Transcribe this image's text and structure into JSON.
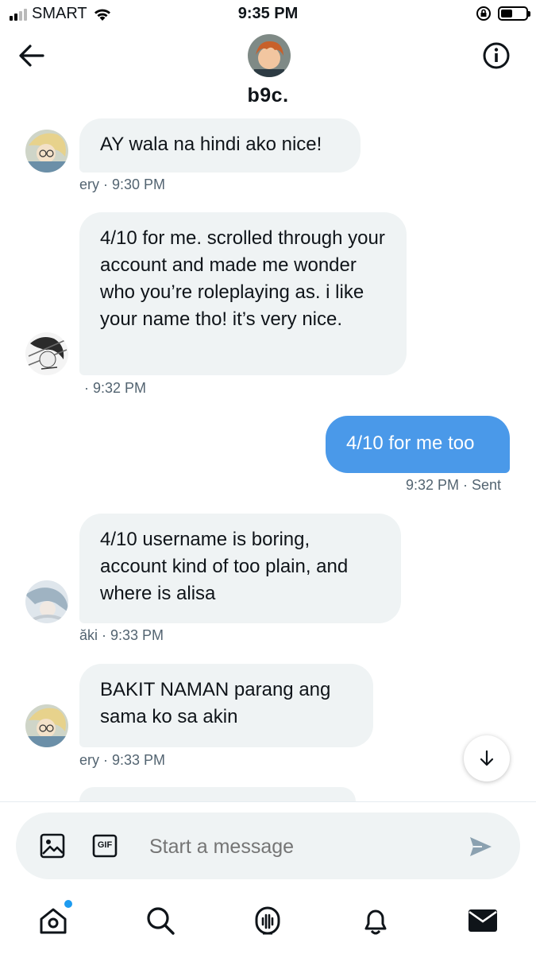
{
  "status_bar": {
    "carrier": "SMART",
    "time": "9:35 PM"
  },
  "header": {
    "title": "b9c.",
    "back_icon": "arrow-left-icon",
    "info_icon": "info-icon"
  },
  "messages": [
    {
      "text": "AY wala na hindi ako nice!",
      "meta": "ery · 9:30 PM",
      "direction": "received"
    },
    {
      "text": "4/10 for me. scrolled through your account and made me wonder who you’re roleplaying as. i like your name tho! it’s very nice.",
      "meta": "· 9:32 PM",
      "direction": "received"
    },
    {
      "text": "4/10 for me too",
      "meta": "9:32 PM  · Sent",
      "direction": "sent"
    },
    {
      "text": "4/10 username is boring, account kind of too plain, and where is alisa",
      "meta": "ăki · 9:33 PM",
      "direction": "received"
    },
    {
      "text": "BAKIT NAMAN parang ang sama ko sa akin",
      "meta": "ery · 9:33 PM",
      "direction": "received"
    }
  ],
  "composer": {
    "placeholder": "Start a message",
    "image_icon": "image-icon",
    "gif_label": "GIF",
    "send_icon": "send-icon"
  },
  "nav": {
    "items": [
      "home-icon",
      "search-icon",
      "spaces-icon",
      "bell-icon",
      "mail-icon"
    ]
  },
  "colors": {
    "accent": "#4a99e9",
    "bubble_received": "#eff3f4",
    "meta_text": "#536471"
  }
}
